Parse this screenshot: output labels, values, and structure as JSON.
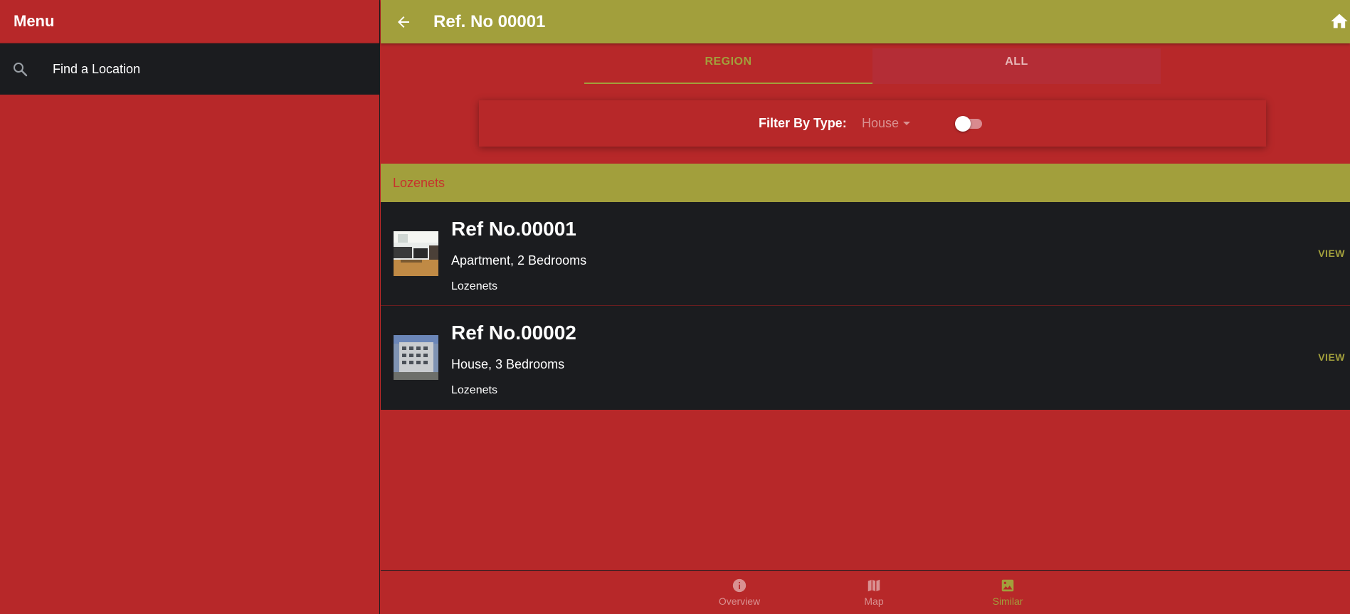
{
  "sidebar": {
    "title": "Menu",
    "search_label": "Find a Location"
  },
  "toolbar": {
    "title": "Ref. No 00001",
    "back_icon": "arrow-left-icon",
    "home_icon": "home-icon"
  },
  "tabs": [
    {
      "label": "REGION",
      "active": true
    },
    {
      "label": "ALL",
      "active": false
    }
  ],
  "filter": {
    "label": "Filter By Type:",
    "selected": "House",
    "toggle_on": false
  },
  "group": {
    "title": "Lozenets"
  },
  "listings": [
    {
      "title": "Ref No.00001",
      "subtitle": "Apartment, 2 Bedrooms",
      "location": "Lozenets",
      "action": "VIEW"
    },
    {
      "title": "Ref No.00002",
      "subtitle": "House, 3 Bedrooms",
      "location": "Lozenets",
      "action": "VIEW"
    }
  ],
  "bottom_nav": [
    {
      "label": "Overview",
      "icon": "info-icon",
      "active": false
    },
    {
      "label": "Map",
      "icon": "map-icon",
      "active": false
    },
    {
      "label": "Similar",
      "icon": "image-icon",
      "active": true
    }
  ],
  "colors": {
    "primary": "#b72829",
    "accent": "#a29f3c",
    "dark": "#1b1c1f"
  }
}
